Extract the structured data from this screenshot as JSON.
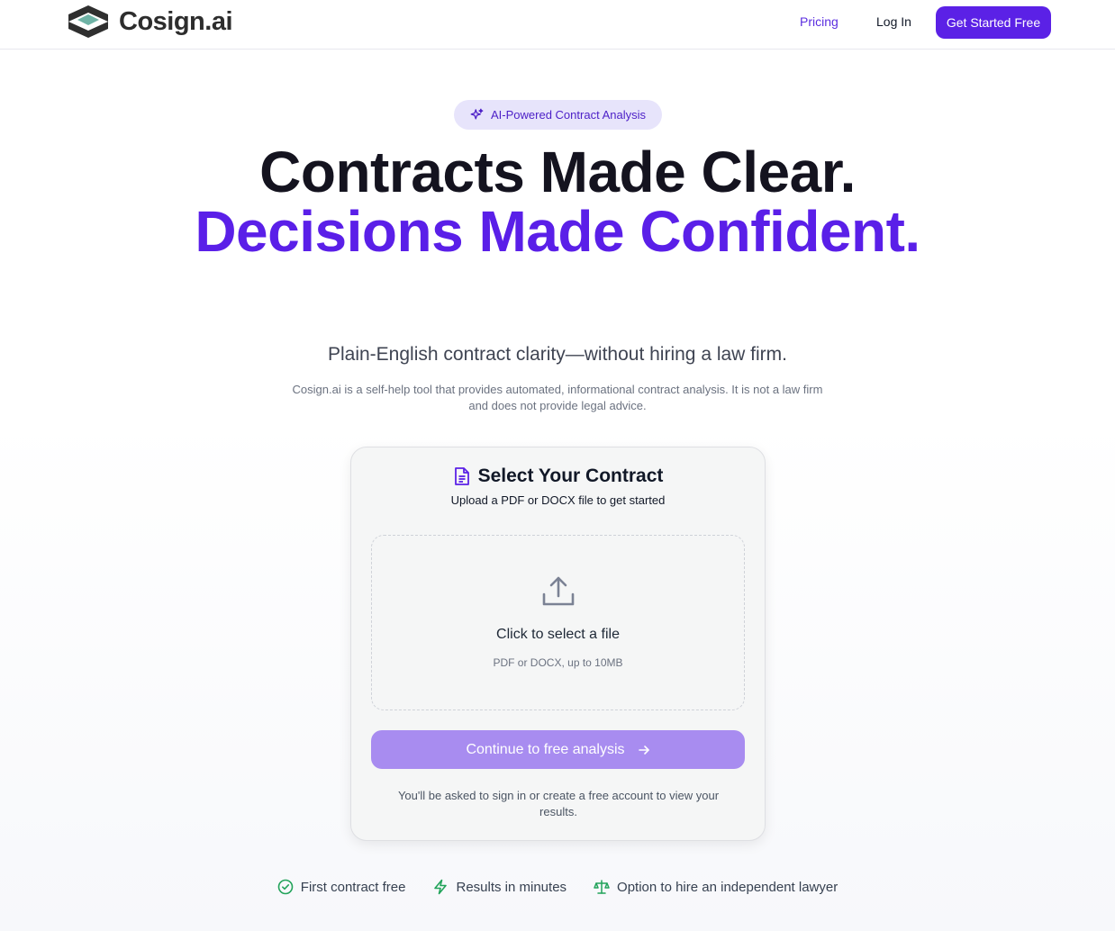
{
  "brand": {
    "name": "Cosign.ai"
  },
  "nav": {
    "pricing": "Pricing",
    "login": "Log In",
    "cta": "Get Started Free"
  },
  "badge": {
    "label": "AI-Powered Contract Analysis"
  },
  "hero": {
    "line1": "Contracts Made Clear.",
    "line2": "Decisions Made Confident."
  },
  "subhead": "Plain-English contract clarity—without hiring a law firm.",
  "disclaimer": "Cosign.ai is a self-help tool that provides automated, informational contract analysis. It is not a law firm and does not provide legal advice.",
  "upload_card": {
    "title": "Select Your Contract",
    "subtitle": "Upload a PDF or DOCX file to get started",
    "dropzone_title": "Click to select a file",
    "dropzone_hint": "PDF or DOCX, up to 10MB",
    "continue_label": "Continue to free analysis",
    "note": "You'll be asked to sign in or create a free account to view your results."
  },
  "features": [
    {
      "label": "First contract free",
      "icon": "check-circle-icon"
    },
    {
      "label": "Results in minutes",
      "icon": "lightning-icon"
    },
    {
      "label": "Option to hire an independent lawyer",
      "icon": "scale-icon"
    }
  ],
  "colors": {
    "accent": "#5b21e6",
    "accent_light": "#a88cf0",
    "badge_bg": "#e7e4fb",
    "feature_icon": "#22a35a"
  }
}
